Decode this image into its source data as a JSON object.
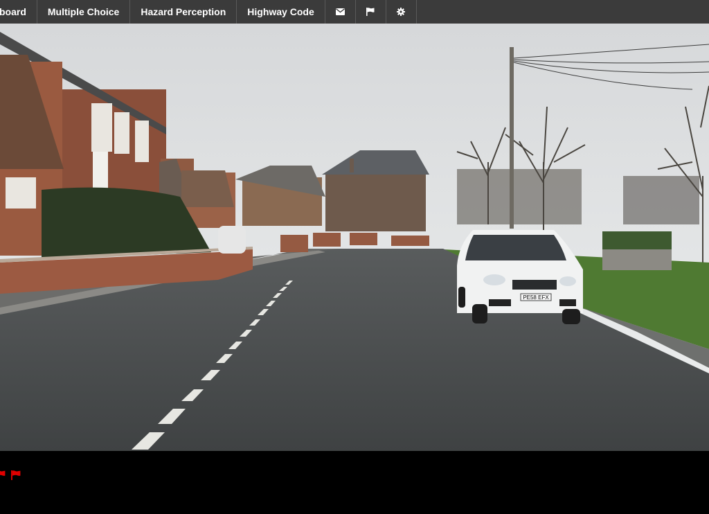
{
  "nav": {
    "items": [
      {
        "label": "board",
        "name": "nav-dashboard"
      },
      {
        "label": "Multiple Choice",
        "name": "nav-multiple-choice"
      },
      {
        "label": "Hazard Perception",
        "name": "nav-hazard-perception"
      },
      {
        "label": "Highway Code",
        "name": "nav-highway-code"
      }
    ],
    "icons": [
      "envelope-icon",
      "flag-icon",
      "gear-icon"
    ]
  },
  "video": {
    "plate": "PE58 EFX"
  },
  "markers": {
    "flag_count": 2,
    "flag_color": "#e00000"
  },
  "colors": {
    "navbar": "#3b3b3b",
    "background": "#000000"
  }
}
